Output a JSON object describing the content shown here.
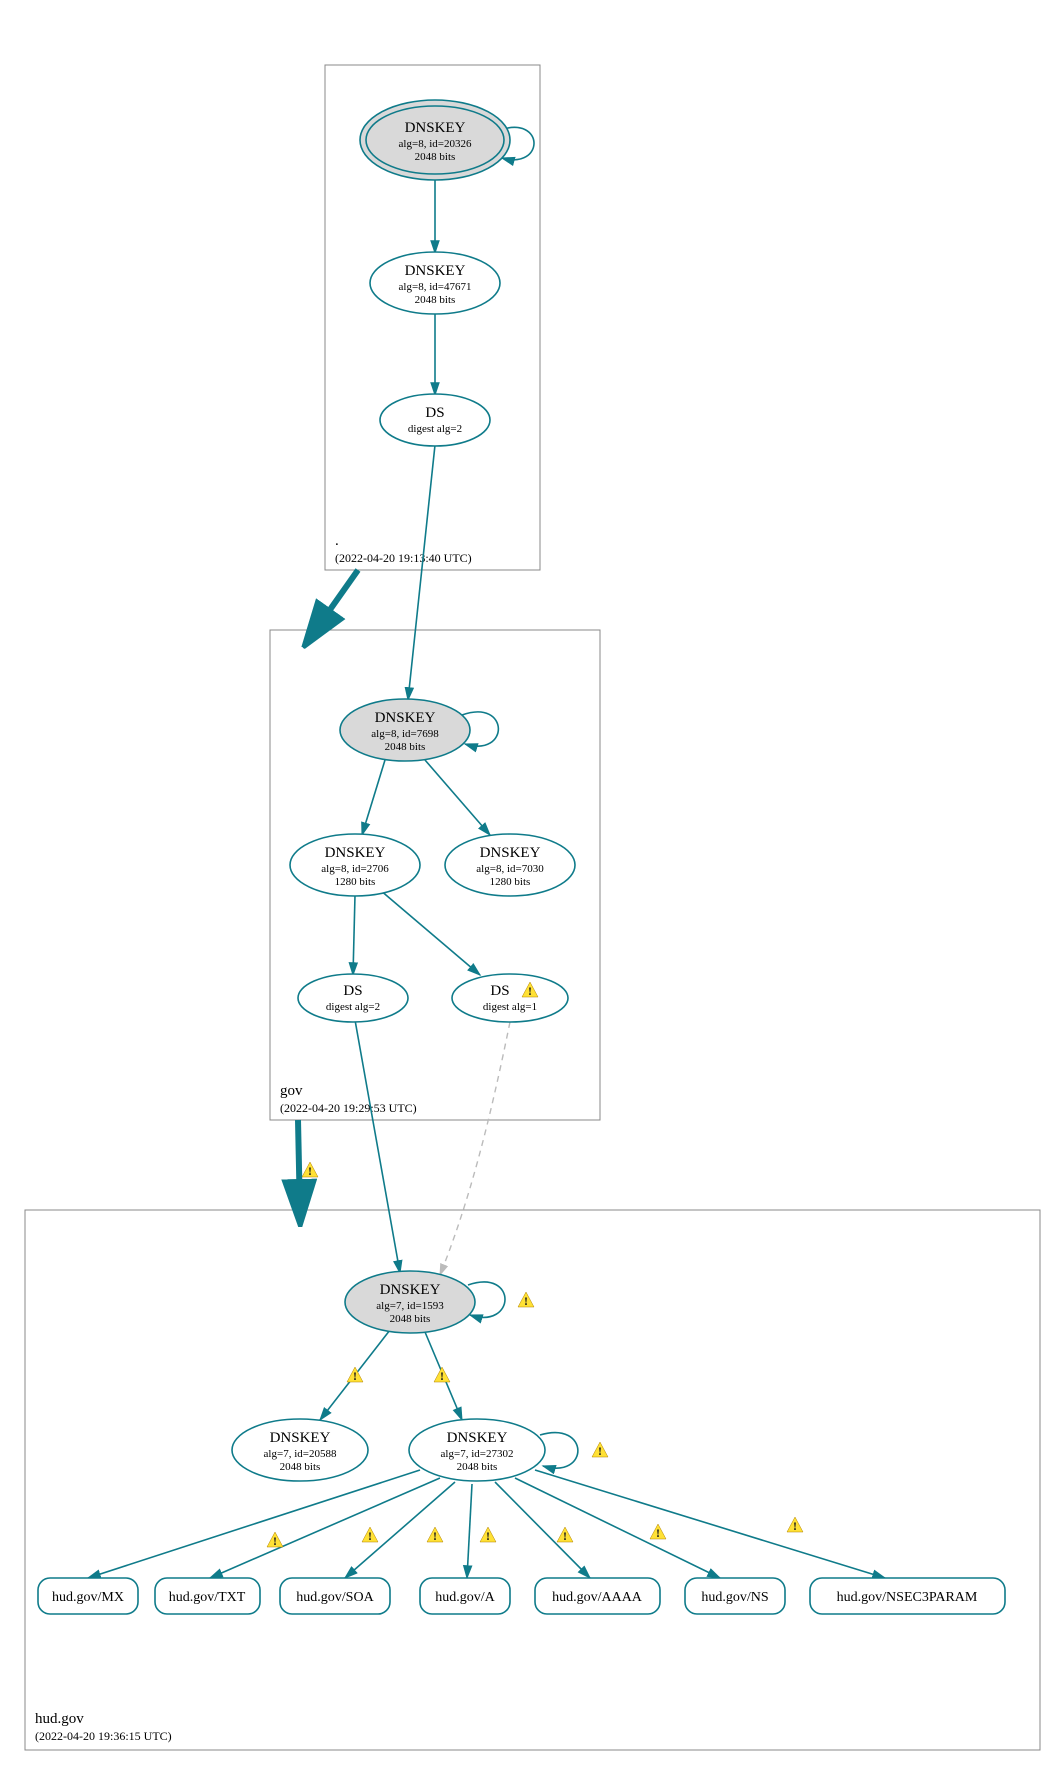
{
  "zones": {
    "root": {
      "label": ".",
      "timestamp": "(2022-04-20 19:13:40 UTC)"
    },
    "gov": {
      "label": "gov",
      "timestamp": "(2022-04-20 19:29:53 UTC)"
    },
    "hud": {
      "label": "hud.gov",
      "timestamp": "(2022-04-20 19:36:15 UTC)"
    }
  },
  "nodes": {
    "root_dnskey_ksk": {
      "title": "DNSKEY",
      "sub1": "alg=8, id=20326",
      "sub2": "2048 bits"
    },
    "root_dnskey_zsk": {
      "title": "DNSKEY",
      "sub1": "alg=8, id=47671",
      "sub2": "2048 bits"
    },
    "root_ds": {
      "title": "DS",
      "sub1": "digest alg=2"
    },
    "gov_dnskey_ksk": {
      "title": "DNSKEY",
      "sub1": "alg=8, id=7698",
      "sub2": "2048 bits"
    },
    "gov_dnskey_2706": {
      "title": "DNSKEY",
      "sub1": "alg=8, id=2706",
      "sub2": "1280 bits"
    },
    "gov_dnskey_7030": {
      "title": "DNSKEY",
      "sub1": "alg=8, id=7030",
      "sub2": "1280 bits"
    },
    "gov_ds2": {
      "title": "DS",
      "sub1": "digest alg=2"
    },
    "gov_ds1": {
      "title": "DS",
      "sub1": "digest alg=1"
    },
    "hud_dnskey_ksk": {
      "title": "DNSKEY",
      "sub1": "alg=7, id=1593",
      "sub2": "2048 bits"
    },
    "hud_dnskey_20588": {
      "title": "DNSKEY",
      "sub1": "alg=7, id=20588",
      "sub2": "2048 bits"
    },
    "hud_dnskey_27302": {
      "title": "DNSKEY",
      "sub1": "alg=7, id=27302",
      "sub2": "2048 bits"
    }
  },
  "records": {
    "mx": "hud.gov/MX",
    "txt": "hud.gov/TXT",
    "soa": "hud.gov/SOA",
    "a": "hud.gov/A",
    "aaaa": "hud.gov/AAAA",
    "ns": "hud.gov/NS",
    "nsec": "hud.gov/NSEC3PARAM"
  }
}
